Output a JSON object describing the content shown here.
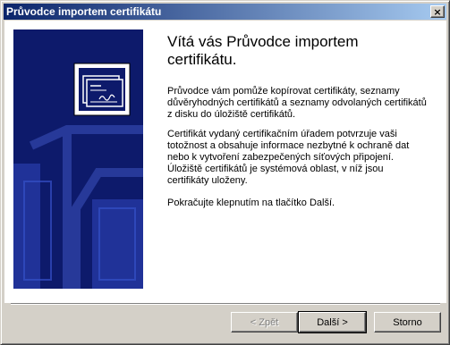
{
  "window": {
    "title": "Průvodce importem certifikátu",
    "close_glyph": "×"
  },
  "welcome": {
    "title": "Vítá vás Průvodce importem certifikátu.",
    "paragraph1": "Průvodce vám pomůže kopírovat certifikáty, seznamy důvěryhodných certifikátů a seznamy odvolaných certifikátů z disku do úložiště certifikátů.",
    "paragraph2": "Certifikát vydaný certifikačním úřadem potvrzuje vaši totožnost a obsahuje informace nezbytné k ochraně dat nebo k vytvoření zabezpečených síťových připojení. Úložiště certifikátů je systémová oblast, v níž jsou certifikáty uloženy.",
    "paragraph3": "Pokračujte klepnutím na tlačítko Další."
  },
  "buttons": {
    "back_label": "< Zpět",
    "next_label": "Další >",
    "cancel_label": "Storno"
  },
  "banner": {
    "icon": "certificate-icon",
    "background_color": "#0d1a6b"
  }
}
